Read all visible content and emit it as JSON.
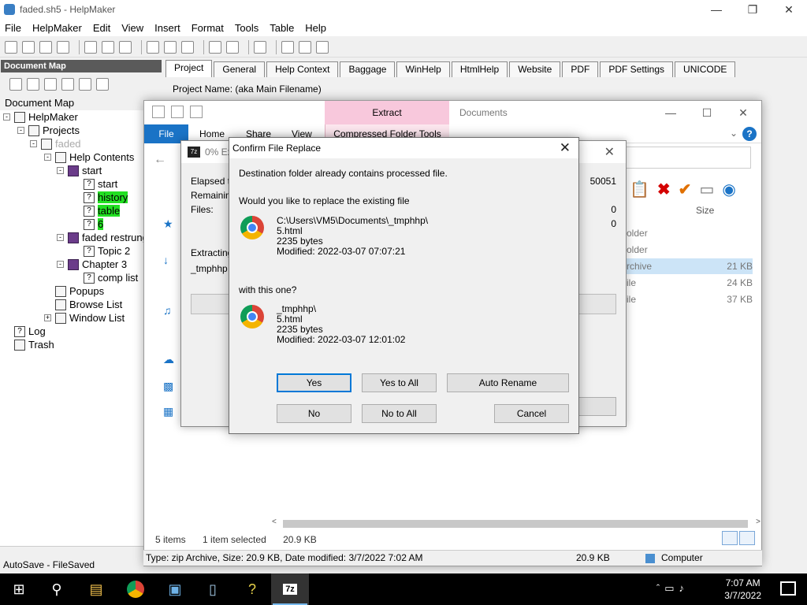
{
  "window": {
    "title": "faded.sh5 - HelpMaker"
  },
  "menu": [
    "File",
    "HelpMaker",
    "Edit",
    "View",
    "Insert",
    "Format",
    "Tools",
    "Table",
    "Help"
  ],
  "doc_map": {
    "header": "Document Map",
    "title": "Document Map",
    "tree": {
      "root": "HelpMaker",
      "projects": "Projects",
      "faded": "faded",
      "help_contents": "Help Contents",
      "start": "start",
      "start_child": "start",
      "history": "history",
      "table": "table",
      "six": "6",
      "faded_restrung": "faded restrung",
      "topic2": "Topic 2",
      "chapter3": "Chapter 3",
      "comp_list": "comp list",
      "popups": "Popups",
      "browse_list": "Browse List",
      "window_list": "Window List",
      "log": "Log",
      "trash": "Trash"
    }
  },
  "autosave": "AutoSave - FileSaved",
  "project_tabs": [
    "Project",
    "General",
    "Help Context",
    "Baggage",
    "WinHelp",
    "HtmlHelp",
    "Website",
    "PDF",
    "PDF Settings",
    "UNICODE"
  ],
  "project_name_label": "Project Name: (aka Main Filename)",
  "explorer": {
    "extract_tab": "Extract",
    "title": "Documents",
    "ribbon_tabs": [
      "File",
      "Home",
      "Share",
      "View"
    ],
    "compressed_tools": "Compressed Folder Tools",
    "column_size": "Size",
    "rows": [
      {
        "type": "older",
        "size": ""
      },
      {
        "type": "older",
        "size": ""
      },
      {
        "type": "rchive",
        "size": "21 KB"
      },
      {
        "type": "ile",
        "size": "24 KB"
      },
      {
        "type": "ile",
        "size": "37 KB"
      }
    ],
    "status_items": "5 items",
    "status_selected": "1 item selected",
    "status_size": "20.9 KB"
  },
  "helpmaker_status": {
    "type_info": "Type: zip Archive, Size: 20.9 KB, Date modified: 3/7/2022 7:02 AM",
    "size": "20.9 KB",
    "location": "Computer"
  },
  "progress_dialog": {
    "title": "0% Ex",
    "elapsed_label": "Elapsed ti",
    "remaining_label": "Remaining",
    "files_label": "Files:",
    "extracting_label": "Extracting",
    "current_item": "_tmphhp",
    "size_value": "50051",
    "files_value": "0",
    "errors_value": "0"
  },
  "confirm": {
    "title": "Confirm File Replace",
    "msg1": "Destination folder already contains processed file.",
    "msg2": "Would you like to replace the existing file",
    "existing": {
      "path": "C:\\Users\\VM5\\Documents\\_tmphhp\\",
      "name": "5.html",
      "size": "2235 bytes",
      "modified": "Modified: 2022-03-07 07:07:21"
    },
    "msg3": "with this one?",
    "incoming": {
      "path": "_tmphhp\\",
      "name": "5.html",
      "size": "2235 bytes",
      "modified": "Modified: 2022-03-07 12:01:02"
    },
    "buttons": {
      "yes": "Yes",
      "yes_to_all": "Yes to All",
      "auto_rename": "Auto Rename",
      "no": "No",
      "no_to_all": "No to All",
      "cancel": "Cancel"
    }
  },
  "taskbar": {
    "time": "7:07 AM",
    "date": "3/7/2022",
    "active_app": "7z"
  },
  "colors": {
    "accent": "#0078d7",
    "highlight": "#22e022",
    "extract_tab": "#f8c8dc",
    "file_tab": "#1a73c6"
  }
}
